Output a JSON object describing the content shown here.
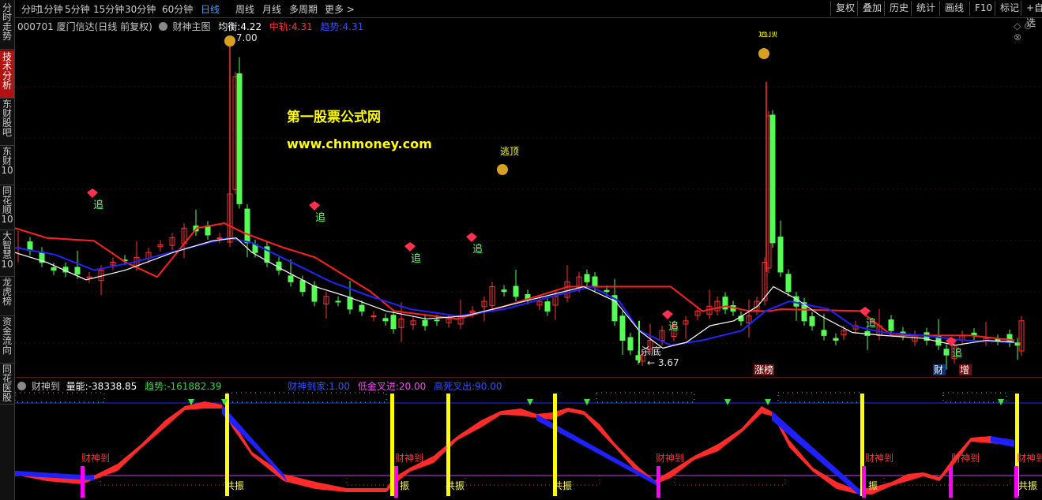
{
  "toolbar": {
    "tabs": [
      "分时",
      "1分钟",
      "5分钟",
      "15分钟",
      "30分钟",
      "60分钟",
      "日线",
      "周线",
      "月线",
      "多周期",
      "更多 >"
    ],
    "active_tab": "日线",
    "right_buttons": [
      "复权",
      "叠加",
      "历史",
      "统计",
      "画线",
      "F10",
      "标记",
      "+自选"
    ]
  },
  "sidebar": {
    "items": [
      "分时走势",
      "技术分析",
      "东财股吧",
      "东财10",
      "同花顺10",
      "大智慧10",
      "龙虎榜",
      "资金流向",
      "同花医股"
    ],
    "active": "技术分析"
  },
  "main_info": {
    "stock": "000701 厦门信达(日线 前复权)",
    "indicator": "财神主图",
    "avg_label": "均衡:",
    "avg_value": "4.22",
    "mid_label": "中轨:",
    "mid_value": "4.31",
    "trend_label": "趋势:",
    "trend_value": "4.31"
  },
  "sub_info": {
    "indicator": "财神到",
    "energy_label": "量能:",
    "energy_value": "-38338.85",
    "trend_label": "趋势:",
    "trend_value": "-161882.39",
    "arrive_label": "财神到家:",
    "arrive_value": "1.00",
    "low_gold_label": "低金叉进:",
    "low_gold_value": "20.00",
    "high_dead_label": "高死叉出:",
    "high_dead_value": "90.00"
  },
  "annotations": {
    "high_price": "7.00",
    "low_price": "3.67",
    "escape_top": "逃顶",
    "kill_bottom": "杀底",
    "chase": "追",
    "watermark_cn": "第一股票公式网",
    "watermark_url": "www.chnmoney.com",
    "badge_limit": "涨榜",
    "badge_cai": "财",
    "badge_zeng": "增",
    "god_arrive": "财神到",
    "resonance": "共振",
    "zhen": "振"
  },
  "colors": {
    "up": "#ff3232",
    "down": "#54ff54",
    "mid_line": "#ff2020",
    "trend_line": "#2222ff",
    "avg_line": "#ffffff",
    "yellow": "#ffff00",
    "magenta": "#ff00ff",
    "watermark": "#ffff00"
  },
  "chart_data": {
    "type": "candlestick",
    "title": "000701 厦门信达(日线 前复权)",
    "marked_high": 7.0,
    "marked_low": 3.67,
    "series": [
      {
        "name": "均衡",
        "last": 4.22
      },
      {
        "name": "中轨",
        "last": 4.31
      },
      {
        "name": "趋势",
        "last": 4.31
      }
    ],
    "sub_series": [
      {
        "name": "量能",
        "last": -38338.85
      },
      {
        "name": "趋势",
        "last": -161882.39
      }
    ]
  }
}
